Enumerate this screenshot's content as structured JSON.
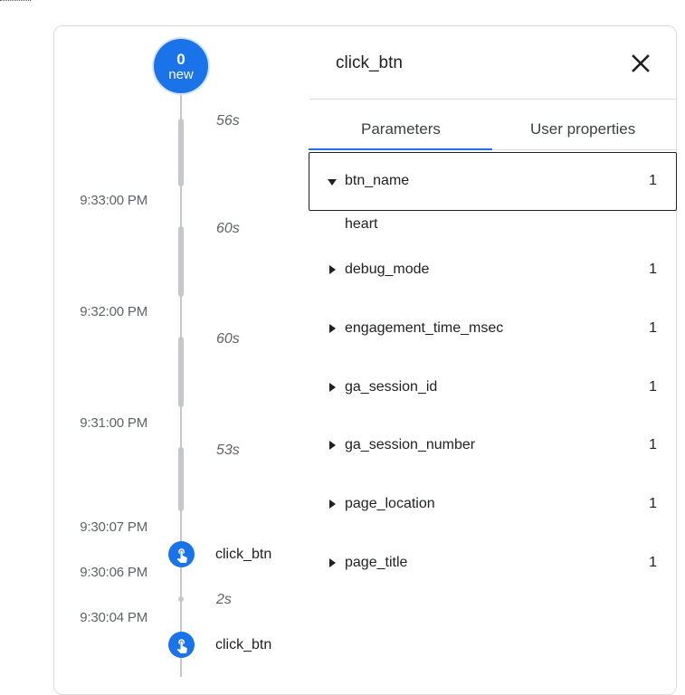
{
  "badge": {
    "count": "0",
    "label": "new"
  },
  "timeline": {
    "durations": [
      "56s",
      "60s",
      "60s",
      "53s",
      "2s"
    ],
    "timestamps": [
      "9:33:00 PM",
      "9:32:00 PM",
      "9:31:00 PM",
      "9:30:07 PM",
      "9:30:06 PM",
      "9:30:04 PM"
    ],
    "events": [
      {
        "label": "click_btn",
        "icon": "touch-icon"
      },
      {
        "label": "click_btn",
        "icon": "touch-icon"
      }
    ]
  },
  "panel": {
    "title": "click_btn",
    "close_icon": "close-icon",
    "tabs": [
      {
        "label": "Parameters",
        "active": true
      },
      {
        "label": "User properties",
        "active": false
      }
    ],
    "parameters": [
      {
        "name": "btn_name",
        "count": "1",
        "expanded": true,
        "value": "heart"
      },
      {
        "name": "debug_mode",
        "count": "1",
        "expanded": false
      },
      {
        "name": "engagement_time_msec",
        "count": "1",
        "expanded": false
      },
      {
        "name": "ga_session_id",
        "count": "1",
        "expanded": false
      },
      {
        "name": "ga_session_number",
        "count": "1",
        "expanded": false
      },
      {
        "name": "page_location",
        "count": "1",
        "expanded": false
      },
      {
        "name": "page_title",
        "count": "1",
        "expanded": false
      }
    ]
  },
  "colors": {
    "accent": "#1a73e8",
    "timeline": "#c5c7ca",
    "muted_text": "#5f6368",
    "divider": "#dadce0"
  }
}
